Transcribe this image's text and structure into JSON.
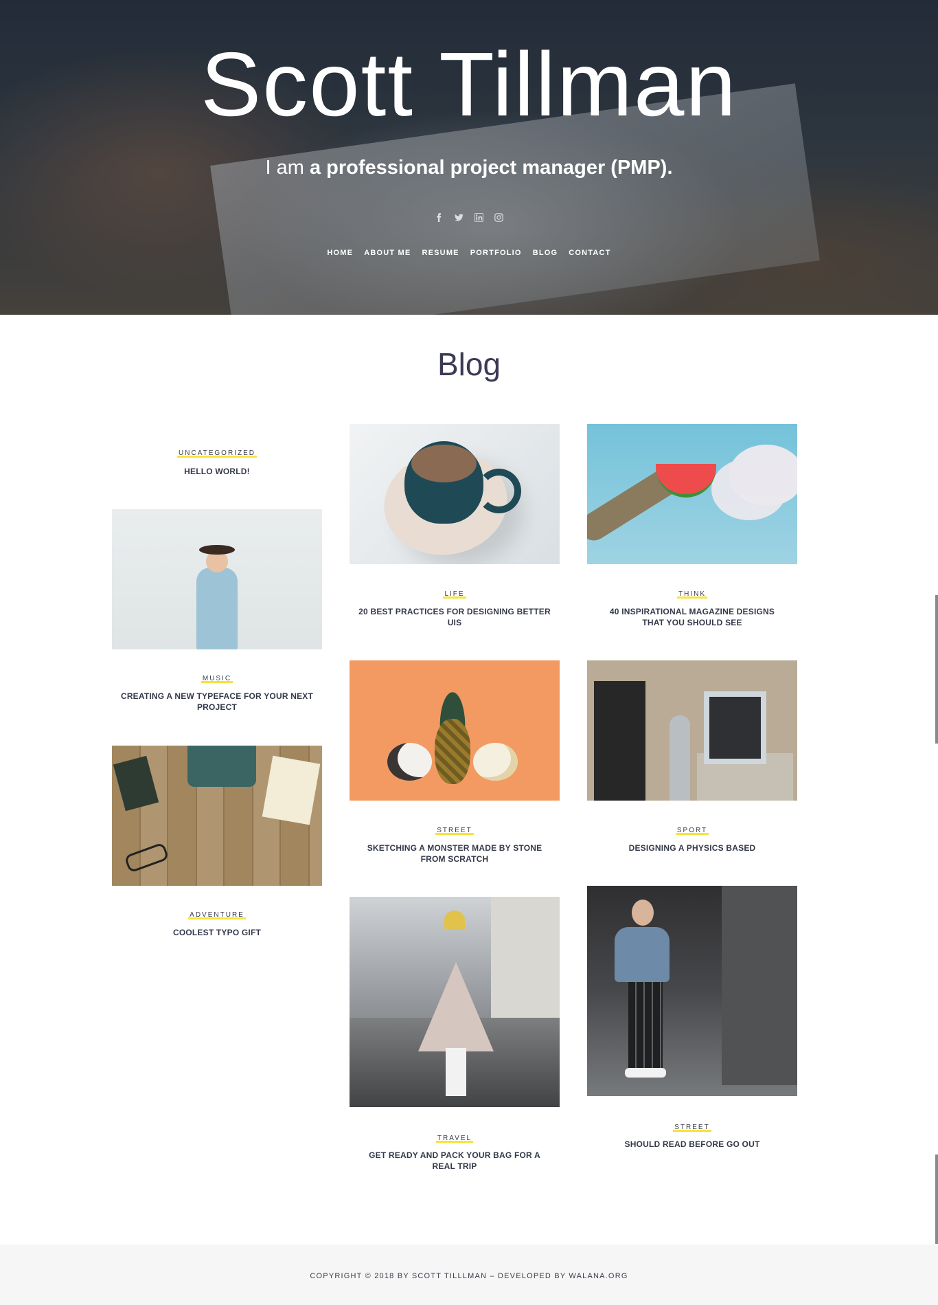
{
  "hero": {
    "title": "Scott Tillman",
    "tagline_prefix": "I am",
    "tagline_bold": "a professional project manager (PMP).",
    "social": [
      {
        "icon": "facebook-icon",
        "label": "f"
      },
      {
        "icon": "twitter-icon",
        "label": "t"
      },
      {
        "icon": "linkedin-icon",
        "label": "in"
      },
      {
        "icon": "instagram-icon",
        "label": "ig"
      }
    ],
    "nav": [
      "HOME",
      "ABOUT ME",
      "RESUME",
      "PORTFOLIO",
      "BLOG",
      "CONTACT"
    ]
  },
  "blog": {
    "heading": "Blog",
    "posts": [
      {
        "category": "UNCATEGORIZED",
        "title": "HELLO WORLD!"
      },
      {
        "category": "LIFE",
        "title": "20 BEST PRACTICES FOR DESIGNING BETTER UIS"
      },
      {
        "category": "THINK",
        "title": "40 INSPIRATIONAL MAGAZINE DESIGNS THAT YOU SHOULD SEE"
      },
      {
        "category": "MUSIC",
        "title": "CREATING A NEW TYPEFACE FOR YOUR NEXT PROJECT"
      },
      {
        "category": "STREET",
        "title": "SKETCHING A MONSTER MADE BY STONE FROM SCRATCH"
      },
      {
        "category": "SPORT",
        "title": "DESIGNING A PHYSICS BASED"
      },
      {
        "category": "ADVENTURE",
        "title": "COOLEST TYPO GIFT"
      },
      {
        "category": "TRAVEL",
        "title": "GET READY AND PACK YOUR BAG FOR A REAL TRIP"
      },
      {
        "category": "STREET",
        "title": "SHOULD READ BEFORE GO OUT"
      }
    ]
  },
  "footer": {
    "copyright": "COPYRIGHT © 2018 BY SCOTT TILLLMAN – DEVELOPED BY WALANA.ORG"
  },
  "colors": {
    "accent_highlight": "#f7e33a",
    "text_dark": "#34394a",
    "footer_bg": "#f6f6f6"
  }
}
